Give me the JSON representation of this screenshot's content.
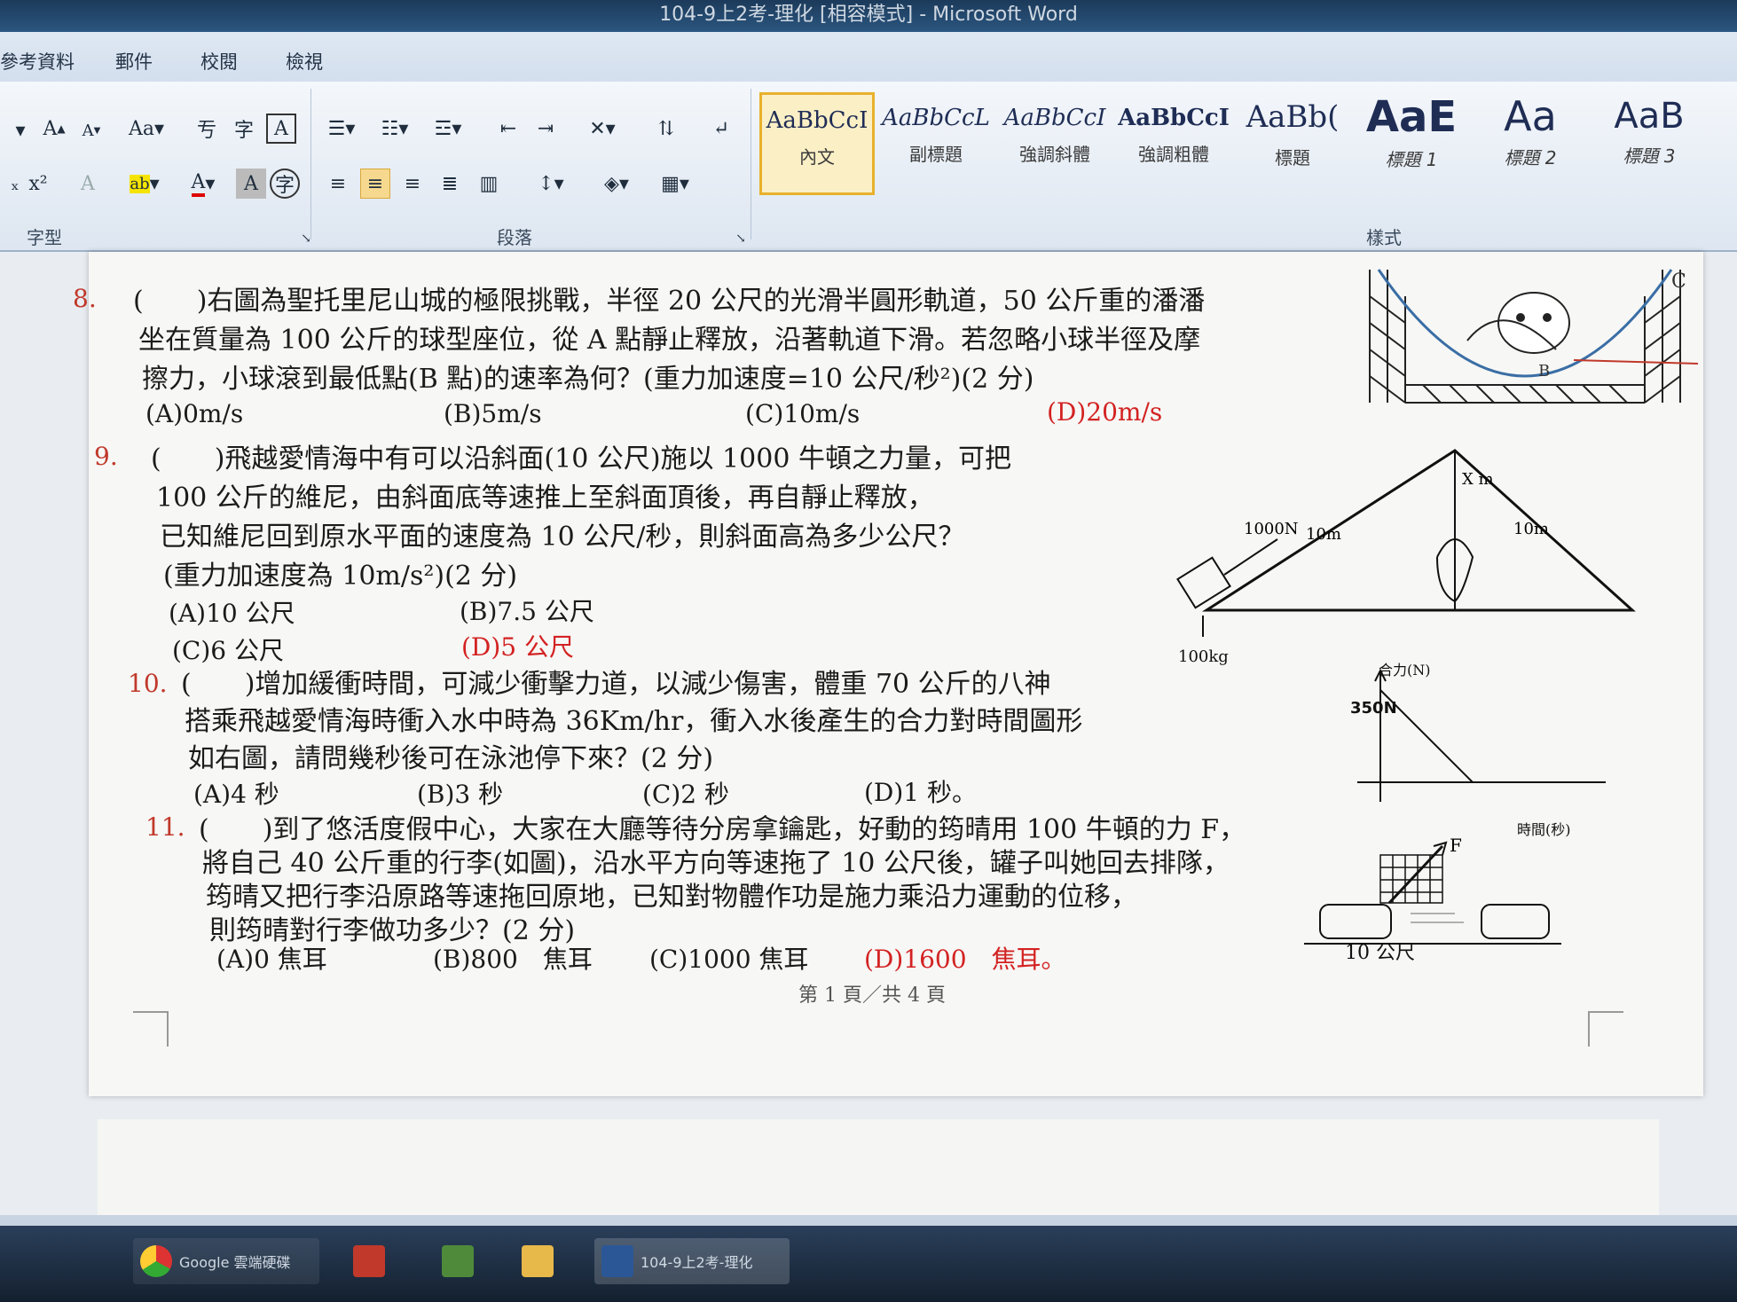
{
  "window": {
    "title": "104-9上2考-理化 [相容模式] - Microsoft Word"
  },
  "ribbon_tabs": [
    "參考資料",
    "郵件",
    "校閱",
    "檢視"
  ],
  "ribbon_groups": {
    "font": "字型",
    "paragraph": "段落",
    "styles": "樣式"
  },
  "font_buttons": {
    "grow": "A",
    "shrink": "A",
    "case": "Aa",
    "highlight": "ab",
    "font_color": "A"
  },
  "styles": [
    {
      "preview": "AaBbCcI",
      "name": "內文",
      "selected": true
    },
    {
      "preview": "AaBbCcL",
      "name": "副標題"
    },
    {
      "preview": "AaBbCcI",
      "name": "強調斜體"
    },
    {
      "preview": "AaBbCcI",
      "name": "強調粗體"
    },
    {
      "preview": "AaBb(",
      "name": "標題"
    },
    {
      "preview": "AaE",
      "name": "標題 1"
    },
    {
      "preview": "Aa",
      "name": "標題 2"
    },
    {
      "preview": "AaB",
      "name": "標題 3"
    }
  ],
  "questions": {
    "q8": {
      "num": "8.",
      "lines": [
        "(　　)右圖為聖托里尼山城的極限挑戰，半徑 20 公尺的光滑半圓形軌道，50 公斤重的潘潘",
        "坐在質量為 100 公斤的球型座位，從 A 點靜止釋放，沿著軌道下滑。若忽略小球半徑及摩",
        "擦力，小球滾到最低點(B 點)的速率為何？(重力加速度=10 公尺/秒²)(2 分)"
      ],
      "options": [
        "(A)0m/s",
        "(B)5m/s",
        "(C)10m/s",
        "(D)20m/s"
      ]
    },
    "q9": {
      "num": "9.",
      "lines": [
        "(　　)飛越愛情海中有可以沿斜面(10 公尺)施以 1000 牛頓之力量，可把",
        "100 公斤的維尼，由斜面底等速推上至斜面頂後，再自靜止釋放，",
        "已知維尼回到原水平面的速度為 10 公尺/秒，則斜面高為多少公尺？",
        "(重力加速度為 10m/s²)(2 分)"
      ],
      "options": [
        "(A)10 公尺",
        "(B)7.5 公尺",
        "(C)6 公尺",
        "(D)5 公尺"
      ]
    },
    "q10": {
      "num": "10.",
      "lines": [
        "(　　)增加緩衝時間，可減少衝擊力道，以減少傷害，體重 70 公斤的八神",
        "搭乘飛越愛情海時衝入水中時為 36Km/hr，衝入水後產生的合力對時間圖形",
        "如右圖，請問幾秒後可在泳池停下來？(2 分)"
      ],
      "options": [
        "(A)4 秒",
        "(B)3 秒",
        "(C)2 秒",
        "(D)1 秒。"
      ]
    },
    "q11": {
      "num": "11.",
      "lines": [
        "(　　)到了悠活度假中心，大家在大廳等待分房拿鑰匙，好動的筠晴用 100 牛頓的力 F，",
        "將自己 40 公斤重的行李(如圖)，沿水平方向等速拖了 10 公尺後，罐子叫她回去排隊，",
        "筠晴又把行李沿原路等速拖回原地，已知對物體作功是施力乘沿力運動的位移，",
        "則筠晴對行李做功多少？(2 分)"
      ],
      "options": [
        "(A)0 焦耳",
        "(B)800　焦耳",
        "(C)1000 焦耳",
        "(D)1600　焦耳。"
      ]
    }
  },
  "figures": {
    "track": {
      "label_c": "C",
      "label_b": "B"
    },
    "incline": {
      "force": "1000N",
      "side_left": "10m",
      "side_right": "10m",
      "height": "X m",
      "mass": "100kg"
    },
    "graph": {
      "ylabel": "合力(N)",
      "yvalue": "350N",
      "xlabel": "時間(秒)"
    },
    "luggage": {
      "force": "F",
      "distance": "10 公尺"
    }
  },
  "page_footer": "第 1 頁／共 4 頁",
  "taskbar": {
    "chrome": "Google 雲端硬碟",
    "word": "104-9上2考-理化"
  }
}
